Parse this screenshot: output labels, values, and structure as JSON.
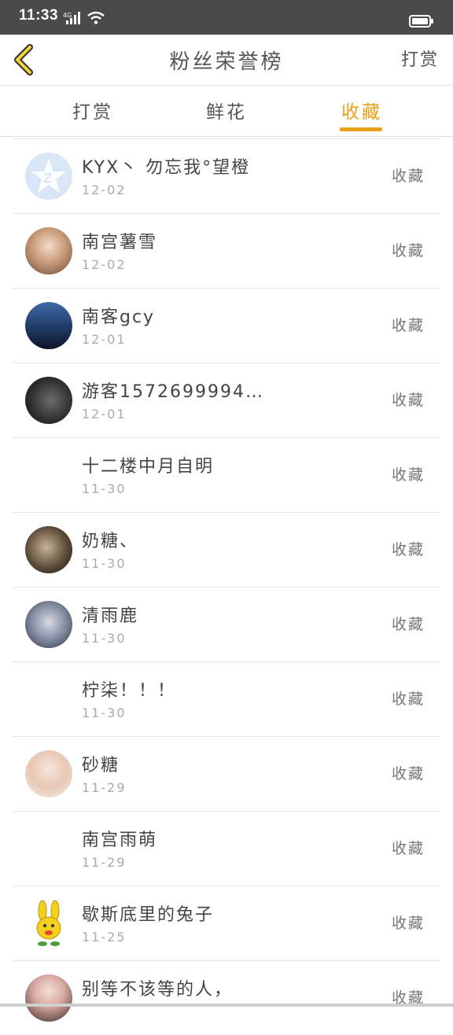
{
  "status": {
    "time": "11:33",
    "network": "4G"
  },
  "header": {
    "title": "粉丝荣誉榜",
    "right_action": "打赏"
  },
  "tabs": [
    {
      "label": "打赏"
    },
    {
      "label": "鲜花"
    },
    {
      "label": "收藏"
    }
  ],
  "active_tab": "收藏",
  "colors": {
    "accent": "#e8a117",
    "statusbar": "#4a4a4a"
  },
  "items": [
    {
      "name": "KYX丶 勿忘我°望橙",
      "date": "12-02",
      "action": "收藏",
      "avatar": "qq-default-icon"
    },
    {
      "name": "南宫薯雪",
      "date": "12-02",
      "action": "收藏",
      "avatar": "photo"
    },
    {
      "name": "南客gcy",
      "date": "12-01",
      "action": "收藏",
      "avatar": "photo"
    },
    {
      "name": "游客1572699994…",
      "date": "12-01",
      "action": "收藏",
      "avatar": "photo"
    },
    {
      "name": "十二楼中月自明",
      "date": "11-30",
      "action": "收藏",
      "avatar": "none"
    },
    {
      "name": "奶糖、",
      "date": "11-30",
      "action": "收藏",
      "avatar": "photo"
    },
    {
      "name": "清雨鹿",
      "date": "11-30",
      "action": "收藏",
      "avatar": "photo"
    },
    {
      "name": "柠柒！！！",
      "date": "11-30",
      "action": "收藏",
      "avatar": "none"
    },
    {
      "name": "砂糖",
      "date": "11-29",
      "action": "收藏",
      "avatar": "photo"
    },
    {
      "name": "南宫雨萌",
      "date": "11-29",
      "action": "收藏",
      "avatar": "none"
    },
    {
      "name": "歇斯底里的兔子",
      "date": "11-25",
      "action": "收藏",
      "avatar": "bunny-icon"
    },
    {
      "name": "别等不该等的人，",
      "date": "",
      "action": "收藏",
      "avatar": "photo"
    }
  ]
}
